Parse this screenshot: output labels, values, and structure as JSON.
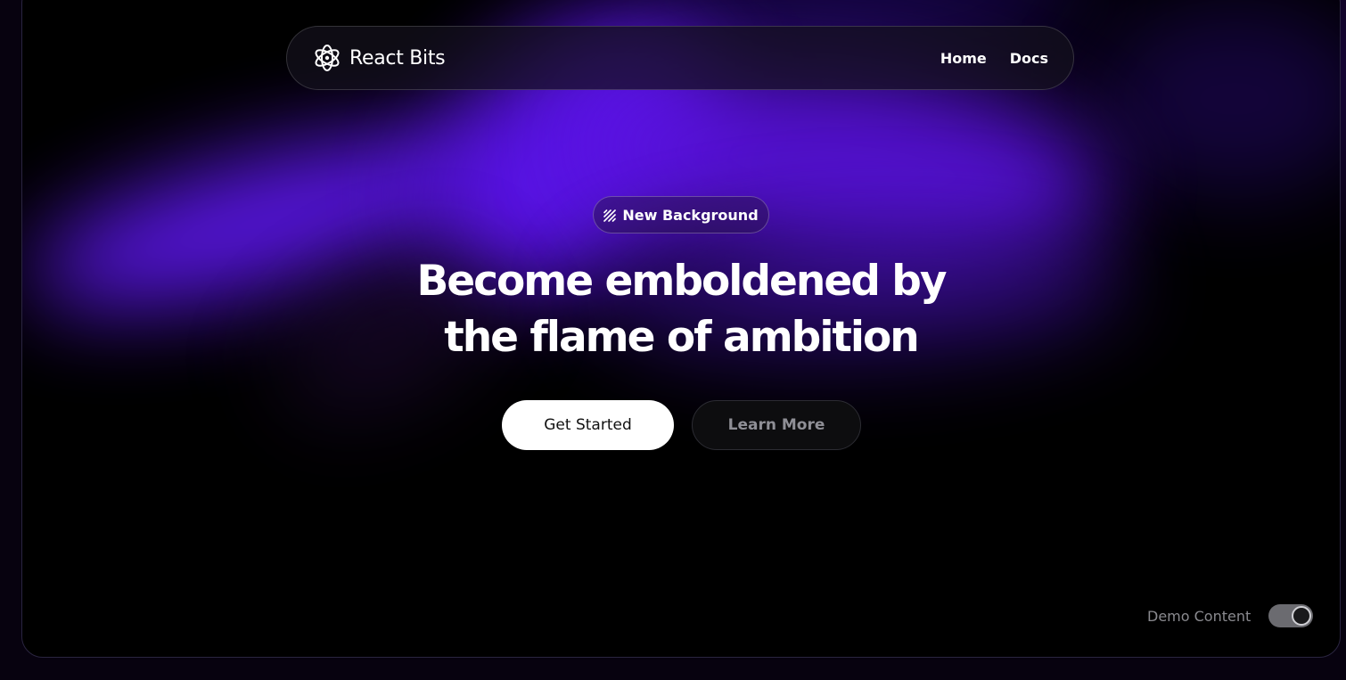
{
  "brand": {
    "name": "React Bits",
    "icon": "atom-icon"
  },
  "nav": {
    "links": [
      "Home",
      "Docs"
    ]
  },
  "hero": {
    "badge": {
      "icon": "hatched-square-icon",
      "label": "New Background"
    },
    "headline": [
      "Become emboldened by",
      "the flame of ambition"
    ],
    "primary_button": "Get Started",
    "secondary_button": "Learn More"
  },
  "demo_toggle": {
    "label": "Demo Content",
    "on": true
  },
  "colors": {
    "accent": "#5c14ee",
    "background": "#000000",
    "text": "#ffffff"
  }
}
